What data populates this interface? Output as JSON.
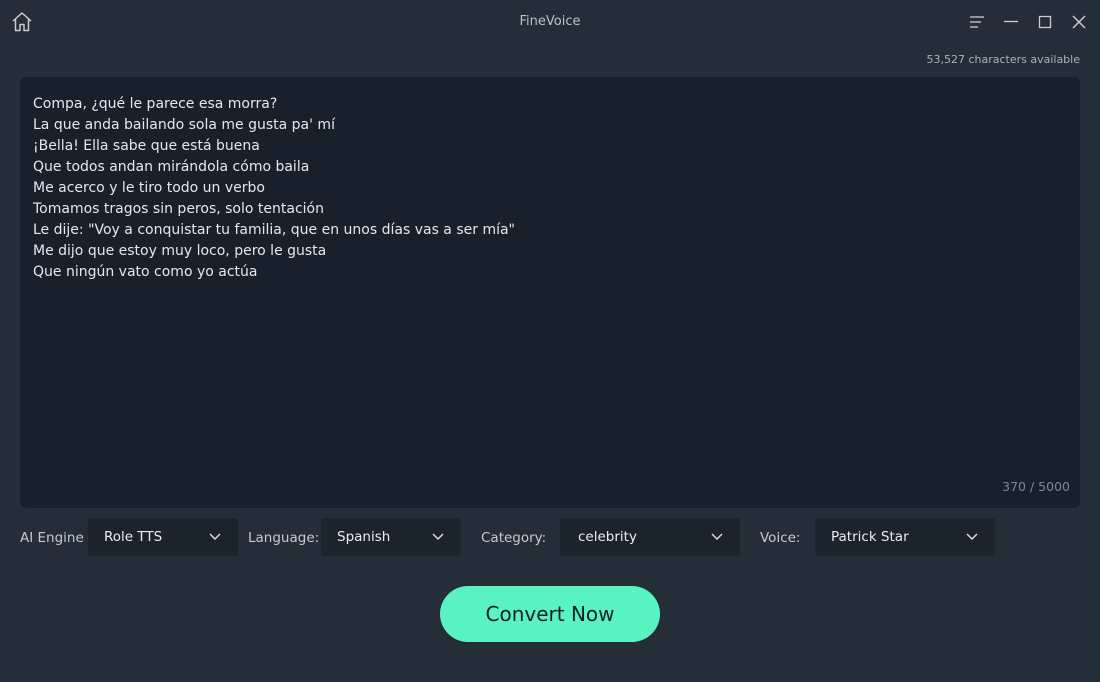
{
  "app": {
    "title": "FineVoice"
  },
  "titlebar": {
    "home_icon": "home-icon",
    "menu_icon": "menu-icon",
    "minimize_icon": "minimize-icon",
    "maximize_icon": "maximize-icon",
    "close_icon": "close-icon"
  },
  "characters_available": "53,527 characters available",
  "editor": {
    "text": "Compa, ¿qué le parece esa morra?\nLa que anda bailando sola me gusta pa' mí\n¡Bella! Ella sabe que está buena\nQue todos andan mirándola cómo baila\nMe acerco y le tiro todo un verbo\nTomamos tragos sin peros, solo tentación\nLe dije: \"Voy a conquistar tu familia, que en unos días vas a ser mía\"\nMe dijo que estoy muy loco, pero le gusta\nQue ningún vato como yo actúa",
    "counter": "370 / 5000"
  },
  "options": {
    "engine": {
      "label": "AI Engine",
      "value": "Role TTS"
    },
    "language": {
      "label": "Language:",
      "value": "Spanish"
    },
    "category": {
      "label": "Category:",
      "value": "celebrity"
    },
    "voice": {
      "label": "Voice:",
      "value": "Patrick Star"
    }
  },
  "convert_button": "Convert Now",
  "colors": {
    "background": "#252e38",
    "editor_background": "#18212b",
    "select_background": "#1b232d",
    "accent": "#59f3c1"
  }
}
